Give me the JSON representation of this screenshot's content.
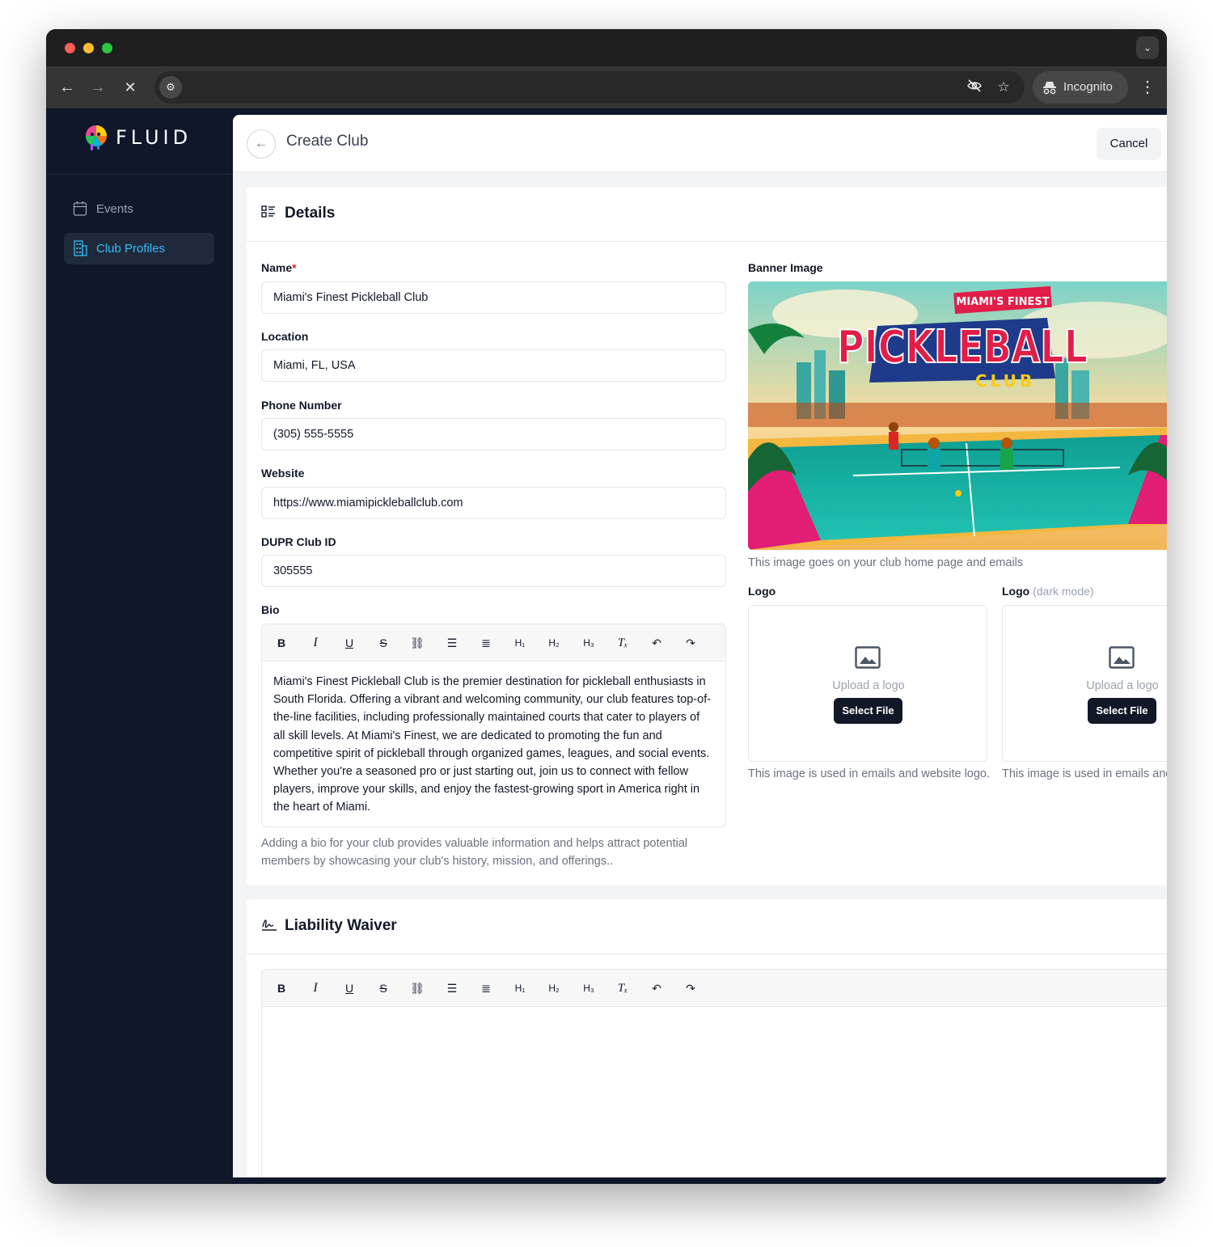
{
  "browser": {
    "incognito_label": "Incognito"
  },
  "sidebar": {
    "brand": "FLUID",
    "items": [
      {
        "label": "Events"
      },
      {
        "label": "Club Profiles"
      }
    ]
  },
  "header": {
    "title": "Create Club",
    "cancel_label": "Cancel"
  },
  "details": {
    "title": "Details",
    "name_label": "Name",
    "name_required": "*",
    "name_value": "Miami's Finest Pickleball Club",
    "location_label": "Location",
    "location_value": "Miami, FL, USA",
    "phone_label": "Phone Number",
    "phone_value": "(305) 555-5555",
    "website_label": "Website",
    "website_value": "https://www.miamipickleballclub.com",
    "dupr_label": "DUPR Club ID",
    "dupr_value": "305555",
    "bio_label": "Bio",
    "bio_text": "Miami's Finest Pickleball Club is the premier destination for pickleball enthusiasts in South Florida. Offering a vibrant and welcoming community, our club features top-of-the-line facilities, including professionally maintained courts that cater to players of all skill levels. At Miami's Finest, we are dedicated to promoting the fun and competitive spirit of pickleball through organized games, leagues, and social events. Whether you're a seasoned pro or just starting out, join us to connect with fellow players, improve your skills, and enjoy the fastest-growing sport in America right in the heart of Miami.",
    "bio_help": "Adding a bio for your club provides valuable information and helps attract potential members by showcasing your club's history, mission, and offerings..",
    "banner_label": "Banner Image",
    "banner_top_text": "MIAMI'S FINEST",
    "banner_main_text": "PICKLEBALL",
    "banner_sub_text": "CLUB",
    "banner_help": "This image goes on your club home page and emails",
    "logo_label": "Logo",
    "logo_dark_label": "Logo",
    "logo_dark_suffix": "(dark mode)",
    "upload_text": "Upload a logo",
    "select_file": "Select File",
    "logo_help": "This image is used in emails and website logo.",
    "logo_dark_help": "This image is used in emails and"
  },
  "waiver": {
    "title": "Liability Waiver"
  },
  "editor_toolbar": [
    "B",
    "I",
    "U",
    "S",
    "link",
    "bullet-list",
    "numbered-list",
    "H1",
    "H2",
    "H3",
    "Tx",
    "undo",
    "redo"
  ],
  "colors": {
    "sidebar_bg": "#0f172a",
    "active_accent": "#38bdf8",
    "primary_button": "#111827",
    "required": "#dc2626"
  }
}
